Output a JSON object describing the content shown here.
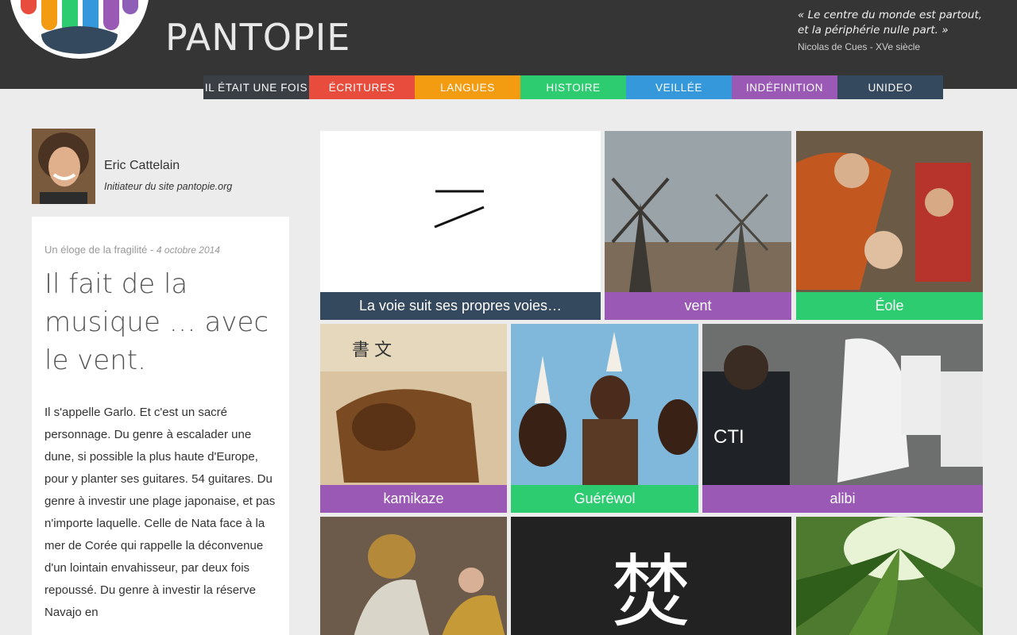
{
  "header": {
    "site_title": "PANTOPIE",
    "quote_line1": "« Le centre du monde est partout,",
    "quote_line2": "et la périphérie nulle part. »",
    "quote_author": "Nicolas de Cues - XVe siècle"
  },
  "nav": [
    {
      "label": "IL ÉTAIT UNE FOIS",
      "color": "#3a3f45"
    },
    {
      "label": "ÉCRITURES",
      "color": "#e74c3c"
    },
    {
      "label": "LANGUES",
      "color": "#f39c12"
    },
    {
      "label": "HISTOIRE",
      "color": "#2ecc71"
    },
    {
      "label": "VEILLÉE",
      "color": "#3498db"
    },
    {
      "label": "INDÉFINITION",
      "color": "#9b59b6"
    },
    {
      "label": "UNIDEO",
      "color": "#34495e"
    }
  ],
  "author": {
    "name": "Eric Cattelain",
    "role": "Initiateur du site pantopie.org"
  },
  "article": {
    "series": "Un éloge de la fragilité",
    "separator": " - ",
    "date": "4 octobre 2014",
    "title": "Il fait de la musique … avec le vent.",
    "paragraph": "Il s'appelle Garlo. Et c'est un sacré personnage. Du genre à escalader une dune, si possible la plus haute d'Europe, pour y planter ses guitares. 54 guitares. Du genre à investir une plage japonaise, et pas n'importe laquelle. Celle de Nata face à la mer de Corée qui rappelle la déconvenue d'un lointain envahisseur, par deux fois repoussé. Du genre à investir la réserve Navajo en"
  },
  "tiles": [
    {
      "caption": "La voie suit ses propres voies…",
      "caption_color": "#34495e",
      "icon": "tao-strokes-icon"
    },
    {
      "caption": "vent",
      "caption_color": "#9b59b6",
      "icon": "windmills-photo"
    },
    {
      "caption": "Éole",
      "caption_color": "#2ecc71",
      "icon": "painting-photo"
    },
    {
      "caption": "kamikaze",
      "caption_color": "#9b59b6",
      "icon": "helmet-photo"
    },
    {
      "caption": "Guéréwol",
      "caption_color": "#2ecc71",
      "icon": "dancers-photo"
    },
    {
      "caption": "alibi",
      "caption_color": "#9b59b6",
      "icon": "forensics-photo"
    },
    {
      "caption": "",
      "caption_color": "",
      "icon": "athena-painting"
    },
    {
      "caption": "",
      "caption_color": "",
      "glyph": "焚"
    },
    {
      "caption": "",
      "caption_color": "",
      "icon": "palm-photo"
    }
  ]
}
